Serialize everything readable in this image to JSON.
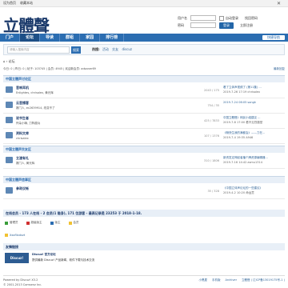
{
  "topbar": {
    "links": [
      "设为首页",
      "收藏本站"
    ],
    "close": "✕"
  },
  "logo": "立體聲",
  "login": {
    "username_label": "用户名",
    "password_label": "密码",
    "username_placeholder": "",
    "password_placeholder": "",
    "remember": "自动登录",
    "forgot": "找回密码",
    "login_button": "登录",
    "register": "立即注册"
  },
  "nav": {
    "tabs": [
      "门户",
      "论坛",
      "导读",
      "群组",
      "家园",
      "排行榜"
    ],
    "quick": "快捷导航"
  },
  "search": {
    "placeholder": "请输入搜索内容",
    "button": "搜索",
    "hot_label": "热搜:",
    "hot": [
      "活动",
      "交友",
      "discuz"
    ]
  },
  "breadcrumb": "⌂ › 论坛",
  "stats": {
    "text": "今日: 0 | 昨日: 0 | 帖子: 103745 | 会员: 4945 | 欢迎新会员: adsaner69",
    "new_posts": "最新回复"
  },
  "categories": [
    {
      "title": "中国立體声讨论区",
      "forums": [
        {
          "name": "音响耳机",
          "new": "(1)",
          "mods": "Enlightes, chrisalex, 黄光辉",
          "counts": "2043 / 175",
          "last_title": "看了立体声视频了 (第11集) ...",
          "last_meta": "2019-7-26 17:19 chrisalex"
        },
        {
          "name": "云音播客",
          "new": "",
          "mods": "赛门人, ec2639914, 改变不了",
          "counts": "754 / 35",
          "last_title": "2019-7-24 06:05 songk",
          "last_meta": ""
        },
        {
          "name": "说书生者",
          "new": "",
          "mods": "怀朵小嘛, 刀阵瘦兵",
          "counts": "425 / 7833",
          "last_title": "中国立體聲》网民小组建议 ...",
          "last_meta": "2019-7-8 17:00 看不见烈魔型"
        },
        {
          "name": "资料文库",
          "new": "",
          "mods": "chrisalex",
          "counts": "107 / 1376",
          "last_title": "《畅快生我的满都会》——力在...",
          "last_meta": "2019-7-4 19:35 A946"
        }
      ]
    },
    {
      "title": "中国立體声交友区",
      "forums": [
        {
          "name": "立渡有礼",
          "new": "",
          "mods": "赛门人, 黄光辉",
          "counts": "310 / 1806",
          "last_title": "新资发定神起者播个牌资源编辑器...",
          "last_meta": "2019-7-16 14:42 asmu1314"
        }
      ]
    },
    {
      "title": "中国立體声信事区",
      "forums": [
        {
          "name": "参政议帐",
          "new": "",
          "mods": "",
          "counts": "35 / 328",
          "last_title": "《中国立体声论坛的一些建议》",
          "last_meta": "2019-4-2 10:20 命运意"
        }
      ]
    }
  ],
  "online": {
    "text": "在线会员 - 173 人在线 - 2 会员(1 隐身), 171 位游客 - 最高记录是 23253 于 2018-1-18."
  },
  "legend": [
    {
      "label": "管理员",
      "color": "#3a9d3a"
    },
    {
      "label": "超级版主",
      "color": "#d03030"
    },
    {
      "label": "版主",
      "color": "#2b6db1"
    },
    {
      "label": "会员",
      "color": "#f1c232"
    }
  ],
  "online_user": "Xxoflixdxzt",
  "links": {
    "title": "友情链接",
    "ad_logo": "Discuz!",
    "ad_title": "Discuz! 官方论坛",
    "ad_desc": "提供最新 Discuz! 产品新闻、软件下载与技术交流"
  },
  "footer": {
    "powered": "Powered by Discuz! X3.2",
    "copyright": "© 2001-2013 Comsenz Inc.",
    "right": [
      "小黑屋",
      "手机版",
      "Archiver",
      "立體聲 ( 辽ICP备13019175号-1 )"
    ]
  }
}
